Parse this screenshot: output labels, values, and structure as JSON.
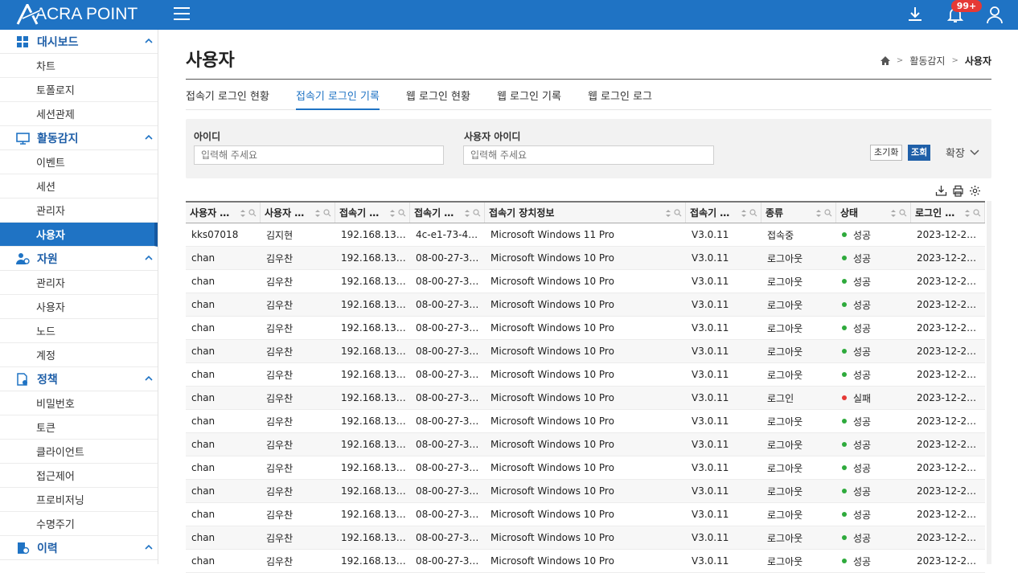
{
  "app": {
    "logo_text": "ACRA POINT",
    "notification_count": "99+"
  },
  "sidebar": {
    "groups": [
      {
        "label": "대시보드",
        "icon": "dashboard-grid-icon",
        "items": [
          "차트",
          "토폴로지",
          "세션관제"
        ]
      },
      {
        "label": "활동감지",
        "icon": "monitor-icon",
        "items": [
          "이벤트",
          "세션",
          "관리자",
          "사용자"
        ]
      },
      {
        "label": "자원",
        "icon": "users-resource-icon",
        "items": [
          "관리자",
          "사용자",
          "노드",
          "계정"
        ]
      },
      {
        "label": "정책",
        "icon": "policy-document-icon",
        "items": [
          "비밀번호",
          "토큰",
          "클라이언트",
          "접근제어",
          "프로비저닝",
          "수명주기"
        ]
      },
      {
        "label": "이력",
        "icon": "history-icon",
        "items": []
      }
    ],
    "active": "사용자"
  },
  "page": {
    "title": "사용자"
  },
  "breadcrumb": {
    "level1": "활동감지",
    "current": "사용자"
  },
  "tabs": [
    "접속기 로그인 현황",
    "접속기 로그인 기록",
    "웹 로그인 현황",
    "웹 로그인 기록",
    "웹 로그인 로그"
  ],
  "active_tab": 1,
  "filter": {
    "id_label": "아이디",
    "id_placeholder": "입력해 주세요",
    "user_id_label": "사용자 아이디",
    "user_id_placeholder": "입력해 주세요",
    "reset_label": "초기화",
    "search_label": "조회",
    "expand_label": "확장"
  },
  "table": {
    "columns": [
      "사용자 …",
      "사용자 …",
      "접속기 …",
      "접속기 …",
      "접속기 장치정보",
      "접속기 …",
      "종류",
      "상태",
      "로그인 …"
    ],
    "rows": [
      [
        "kks07018",
        "김지현",
        "192.168.13…",
        "4c-e1-73-4…",
        "Microsoft Windows 11 Pro",
        "V3.0.11",
        "접속중",
        "성공",
        "2023-12-2…"
      ],
      [
        "chan",
        "김우찬",
        "192.168.13…",
        "08-00-27-3…",
        "Microsoft Windows 10 Pro",
        "V3.0.11",
        "로그아웃",
        "성공",
        "2023-12-2…"
      ],
      [
        "chan",
        "김우찬",
        "192.168.13…",
        "08-00-27-3…",
        "Microsoft Windows 10 Pro",
        "V3.0.11",
        "로그아웃",
        "성공",
        "2023-12-2…"
      ],
      [
        "chan",
        "김우찬",
        "192.168.13…",
        "08-00-27-3…",
        "Microsoft Windows 10 Pro",
        "V3.0.11",
        "로그아웃",
        "성공",
        "2023-12-2…"
      ],
      [
        "chan",
        "김우찬",
        "192.168.13…",
        "08-00-27-3…",
        "Microsoft Windows 10 Pro",
        "V3.0.11",
        "로그아웃",
        "성공",
        "2023-12-2…"
      ],
      [
        "chan",
        "김우찬",
        "192.168.13…",
        "08-00-27-3…",
        "Microsoft Windows 10 Pro",
        "V3.0.11",
        "로그아웃",
        "성공",
        "2023-12-2…"
      ],
      [
        "chan",
        "김우찬",
        "192.168.13…",
        "08-00-27-3…",
        "Microsoft Windows 10 Pro",
        "V3.0.11",
        "로그아웃",
        "성공",
        "2023-12-2…"
      ],
      [
        "chan",
        "김우찬",
        "192.168.13…",
        "08-00-27-3…",
        "Microsoft Windows 10 Pro",
        "V3.0.11",
        "로그인",
        "실패",
        "2023-12-2…"
      ],
      [
        "chan",
        "김우찬",
        "192.168.13…",
        "08-00-27-3…",
        "Microsoft Windows 10 Pro",
        "V3.0.11",
        "로그아웃",
        "성공",
        "2023-12-2…"
      ],
      [
        "chan",
        "김우찬",
        "192.168.13…",
        "08-00-27-3…",
        "Microsoft Windows 10 Pro",
        "V3.0.11",
        "로그아웃",
        "성공",
        "2023-12-2…"
      ],
      [
        "chan",
        "김우찬",
        "192.168.13…",
        "08-00-27-3…",
        "Microsoft Windows 10 Pro",
        "V3.0.11",
        "로그아웃",
        "성공",
        "2023-12-2…"
      ],
      [
        "chan",
        "김우찬",
        "192.168.13…",
        "08-00-27-3…",
        "Microsoft Windows 10 Pro",
        "V3.0.11",
        "로그아웃",
        "성공",
        "2023-12-2…"
      ],
      [
        "chan",
        "김우찬",
        "192.168.13…",
        "08-00-27-3…",
        "Microsoft Windows 10 Pro",
        "V3.0.11",
        "로그아웃",
        "성공",
        "2023-12-2…"
      ],
      [
        "chan",
        "김우찬",
        "192.168.13…",
        "08-00-27-3…",
        "Microsoft Windows 10 Pro",
        "V3.0.11",
        "로그아웃",
        "성공",
        "2023-12-2…"
      ],
      [
        "chan",
        "김우찬",
        "192.168.13…",
        "08-00-27-3…",
        "Microsoft Windows 10 Pro",
        "V3.0.11",
        "로그아웃",
        "성공",
        "2023-12-2…"
      ]
    ]
  },
  "colors": {
    "primary": "#1f73c4",
    "success": "#2eaa3c",
    "fail": "#e53935"
  }
}
